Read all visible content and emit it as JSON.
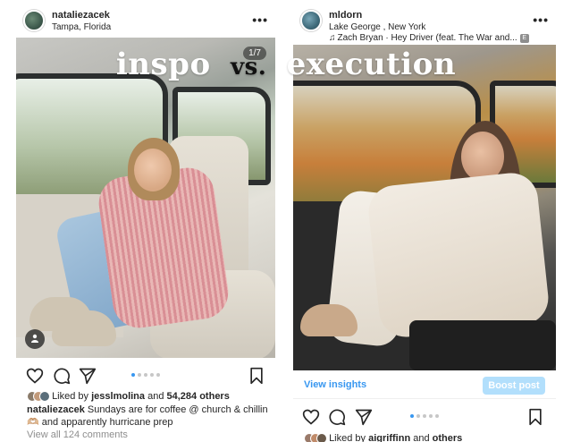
{
  "overlay": {
    "word_left": "inspo",
    "word_mid": "vs.",
    "word_right": "execution"
  },
  "post_left": {
    "username": "nataliezacek",
    "location": "Tampa, Florida",
    "more_label": "•••",
    "slide_counter": "1/7",
    "likes_prefix": "Liked by",
    "likes_user": "jesslmolina",
    "likes_and": "and",
    "likes_count": "54,284 others",
    "caption_user": "nataliezacek",
    "caption_text": "Sundays are for coffee @ church & chillin 🫶🏼 and apparently hurricane prep",
    "view_comments": "View all 124 comments",
    "carousel_total": 5,
    "carousel_active": 1
  },
  "post_right": {
    "username": "mldorn",
    "location": "Lake George , New York",
    "music": "Zach Bryan · Hey Driver (feat. The War and...",
    "explicit": "E",
    "more_label": "•••",
    "view_insights": "View insights",
    "boost_post": "Boost post",
    "likes_prefix": "Liked by",
    "likes_user": "aigriffinn",
    "likes_and": "and",
    "likes_count": "others",
    "carousel_total": 5,
    "carousel_active": 1
  },
  "colors": {
    "accent_blue": "#3897f0",
    "boost_bg": "#b2dffc",
    "text": "#262626",
    "muted": "#8e8e8e"
  }
}
